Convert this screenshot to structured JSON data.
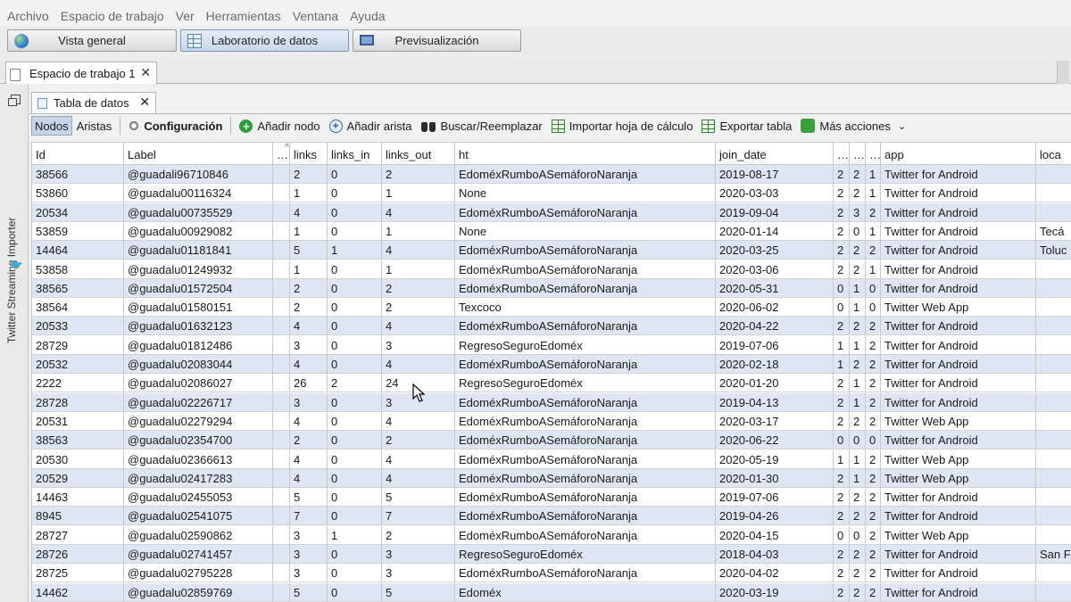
{
  "menu": [
    "Archivo",
    "Espacio de trabajo",
    "Ver",
    "Herramientas",
    "Ventana",
    "Ayuda"
  ],
  "switcher": {
    "overview": "Vista general",
    "data_lab": "Laboratorio de datos",
    "preview": "Previsualización"
  },
  "workspace_tab": "Espacio de trabajo 1",
  "side_panel_label": "Twitter Streaming Importer",
  "data_table_tab": "Tabla de datos",
  "toolbar": {
    "nodes": "Nodos",
    "edges": "Aristas",
    "config": "Configuración",
    "add_node": "Añadir nodo",
    "add_edge": "Añadir arista",
    "search_replace": "Buscar/Reemplazar",
    "import_sheet": "Importar hoja de cálculo",
    "export_table": "Exportar tabla",
    "more_actions": "Más acciones"
  },
  "table": {
    "columns": [
      "Id",
      "Label",
      "…",
      "links",
      "links_in",
      "links_out",
      "ht",
      "join_date",
      "…",
      "…",
      "…",
      "app",
      "loca"
    ],
    "rows": [
      [
        "38566",
        "@guadali96710846",
        "",
        "2",
        "0",
        "2",
        "EdoméxRumboASemáforoNaranja",
        "2019-08-17",
        "2",
        "2",
        "1",
        "Twitter for Android",
        ""
      ],
      [
        "53860",
        "@guadalu00116324",
        "",
        "1",
        "0",
        "1",
        "None",
        "2020-03-03",
        "2",
        "2",
        "1",
        "Twitter for Android",
        ""
      ],
      [
        "20534",
        "@guadalu00735529",
        "",
        "4",
        "0",
        "4",
        "EdoméxRumboASemáforoNaranja",
        "2019-09-04",
        "2",
        "3",
        "2",
        "Twitter for Android",
        ""
      ],
      [
        "53859",
        "@guadalu00929082",
        "",
        "1",
        "0",
        "1",
        "None",
        "2020-01-14",
        "2",
        "0",
        "1",
        "Twitter for Android",
        "Tecá"
      ],
      [
        "14464",
        "@guadalu01181841",
        "",
        "5",
        "1",
        "4",
        "EdoméxRumboASemáforoNaranja",
        "2020-03-25",
        "2",
        "2",
        "2",
        "Twitter for Android",
        "Toluc"
      ],
      [
        "53858",
        "@guadalu01249932",
        "",
        "1",
        "0",
        "1",
        "EdoméxRumboASemáforoNaranja",
        "2020-03-06",
        "2",
        "2",
        "1",
        "Twitter for Android",
        ""
      ],
      [
        "38565",
        "@guadalu01572504",
        "",
        "2",
        "0",
        "2",
        "EdoméxRumboASemáforoNaranja",
        "2020-05-31",
        "0",
        "1",
        "0",
        "Twitter for Android",
        ""
      ],
      [
        "38564",
        "@guadalu01580151",
        "",
        "2",
        "0",
        "2",
        "Texcoco",
        "2020-06-02",
        "0",
        "1",
        "0",
        "Twitter Web App",
        ""
      ],
      [
        "20533",
        "@guadalu01632123",
        "",
        "4",
        "0",
        "4",
        "EdoméxRumboASemáforoNaranja",
        "2020-04-22",
        "2",
        "2",
        "2",
        "Twitter for Android",
        ""
      ],
      [
        "28729",
        "@guadalu01812486",
        "",
        "3",
        "0",
        "3",
        "RegresoSeguroEdoméx",
        "2019-07-06",
        "1",
        "1",
        "2",
        "Twitter for Android",
        ""
      ],
      [
        "20532",
        "@guadalu02083044",
        "",
        "4",
        "0",
        "4",
        "EdoméxRumboASemáforoNaranja",
        "2020-02-18",
        "1",
        "2",
        "2",
        "Twitter for Android",
        ""
      ],
      [
        "2222",
        "@guadalu02086027",
        "",
        "26",
        "2",
        "24",
        "RegresoSeguroEdoméx",
        "2020-01-20",
        "2",
        "1",
        "2",
        "Twitter for Android",
        ""
      ],
      [
        "28728",
        "@guadalu02226717",
        "",
        "3",
        "0",
        "3",
        "EdoméxRumboASemáforoNaranja",
        "2019-04-13",
        "2",
        "1",
        "2",
        "Twitter for Android",
        ""
      ],
      [
        "20531",
        "@guadalu02279294",
        "",
        "4",
        "0",
        "4",
        "EdoméxRumboASemáforoNaranja",
        "2020-03-17",
        "2",
        "2",
        "2",
        "Twitter Web App",
        ""
      ],
      [
        "38563",
        "@guadalu02354700",
        "",
        "2",
        "0",
        "2",
        "EdoméxRumboASemáforoNaranja",
        "2020-06-22",
        "0",
        "0",
        "0",
        "Twitter for Android",
        ""
      ],
      [
        "20530",
        "@guadalu02366613",
        "",
        "4",
        "0",
        "4",
        "EdoméxRumboASemáforoNaranja",
        "2020-05-19",
        "1",
        "1",
        "2",
        "Twitter Web App",
        ""
      ],
      [
        "20529",
        "@guadalu02417283",
        "",
        "4",
        "0",
        "4",
        "EdoméxRumboASemáforoNaranja",
        "2020-01-30",
        "2",
        "1",
        "2",
        "Twitter Web App",
        ""
      ],
      [
        "14463",
        "@guadalu02455053",
        "",
        "5",
        "0",
        "5",
        "EdoméxRumboASemáforoNaranja",
        "2019-07-06",
        "2",
        "2",
        "2",
        "Twitter for Android",
        ""
      ],
      [
        "8945",
        "@guadalu02541075",
        "",
        "7",
        "0",
        "7",
        "EdoméxRumboASemáforoNaranja",
        "2019-04-26",
        "2",
        "2",
        "2",
        "Twitter for Android",
        ""
      ],
      [
        "28727",
        "@guadalu02590862",
        "",
        "3",
        "1",
        "2",
        "EdoméxRumboASemáforoNaranja",
        "2020-04-15",
        "0",
        "0",
        "2",
        "Twitter Web App",
        ""
      ],
      [
        "28726",
        "@guadalu02741457",
        "",
        "3",
        "0",
        "3",
        "RegresoSeguroEdoméx",
        "2018-04-03",
        "2",
        "2",
        "2",
        "Twitter for Android",
        "San F"
      ],
      [
        "28725",
        "@guadalu02795228",
        "",
        "3",
        "0",
        "3",
        "EdoméxRumboASemáforoNaranja",
        "2020-04-02",
        "2",
        "2",
        "2",
        "Twitter for Android",
        ""
      ],
      [
        "14462",
        "@guadalu02859769",
        "",
        "5",
        "0",
        "5",
        "Edoméx",
        "2020-03-19",
        "2",
        "2",
        "2",
        "Twitter for Android",
        ""
      ]
    ]
  },
  "colors": {
    "row_alt": "#dfe6f3",
    "active_toggle": "#c7d4e8"
  }
}
